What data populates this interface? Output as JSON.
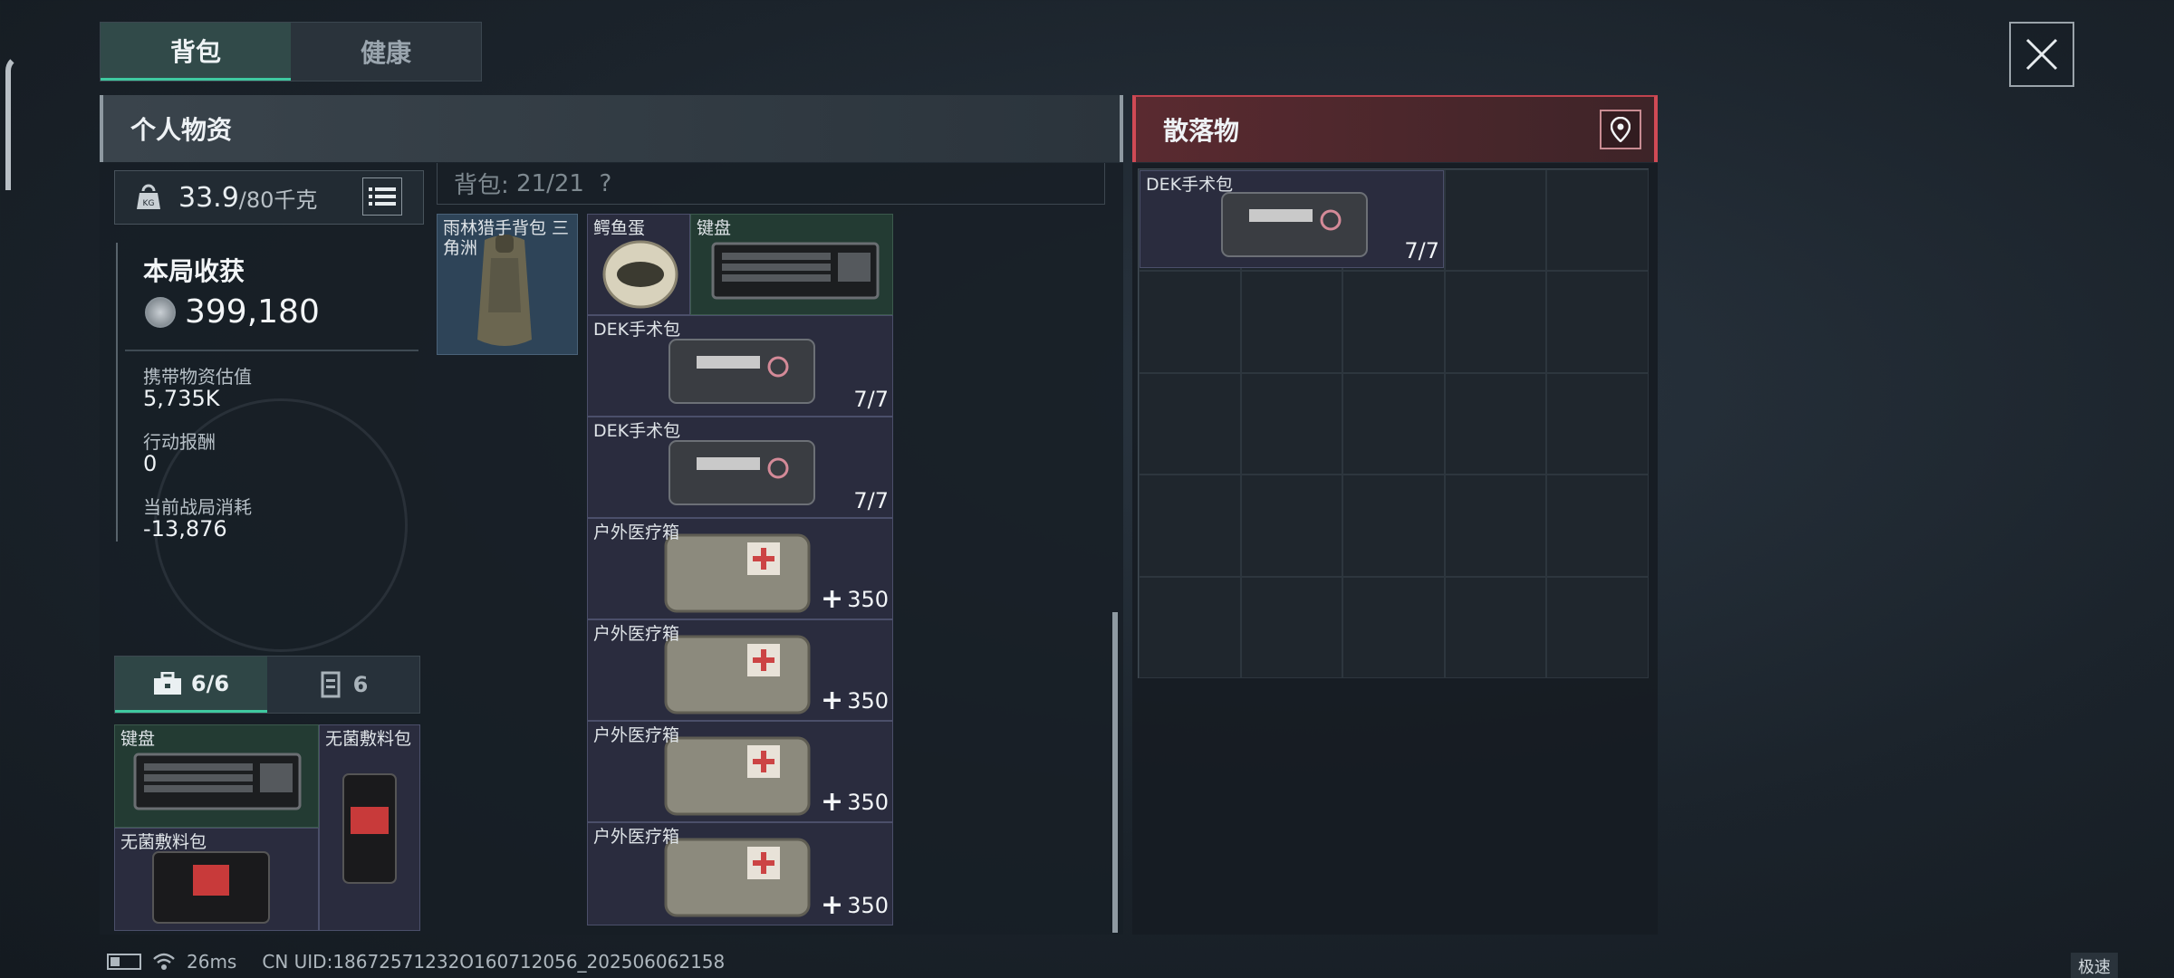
{
  "tabs": [
    "背包",
    "健康"
  ],
  "personal_header": "个人物资",
  "loot_header": "散落物",
  "weight": {
    "value": "33.9",
    "unit": "/80千克"
  },
  "stats": {
    "title": "本局收获",
    "total": "399,180",
    "carry_label": "携带物资估值",
    "carry_value": "5,735K",
    "reward_label": "行动报酬",
    "reward_value": "0",
    "cost_label": "当前战局消耗",
    "cost_value": "-13,876"
  },
  "bag": {
    "label": "背包:",
    "count": "21/21",
    "help": "?"
  },
  "backpack_slot": {
    "name": "雨林猎手背包 三角洲"
  },
  "bag_items": [
    {
      "name": "鳄鱼蛋",
      "count": ""
    },
    {
      "name": "键盘",
      "count": ""
    },
    {
      "name": "DEK手术包",
      "count": "7/7"
    },
    {
      "name": "DEK手术包",
      "count": "7/7"
    },
    {
      "name": "户外医疗箱",
      "count": "350"
    },
    {
      "name": "户外医疗箱",
      "count": "350"
    },
    {
      "name": "户外医疗箱",
      "count": "350"
    },
    {
      "name": "户外医疗箱",
      "count": "350"
    }
  ],
  "subtabs": [
    {
      "label": "6/6",
      "icon": "toolbox-icon"
    },
    {
      "label": "6",
      "icon": "vest-icon"
    }
  ],
  "pouch_items": [
    {
      "name": "键盘"
    },
    {
      "name": "无菌敷料包"
    },
    {
      "name": "无菌敷料包"
    }
  ],
  "loot_items": [
    {
      "name": "DEK手术包",
      "count": "7/7"
    }
  ],
  "status": {
    "ping": "26ms",
    "uid": "CN UID:18672571232O160712056_202506062158"
  },
  "speed_badge": "极速"
}
